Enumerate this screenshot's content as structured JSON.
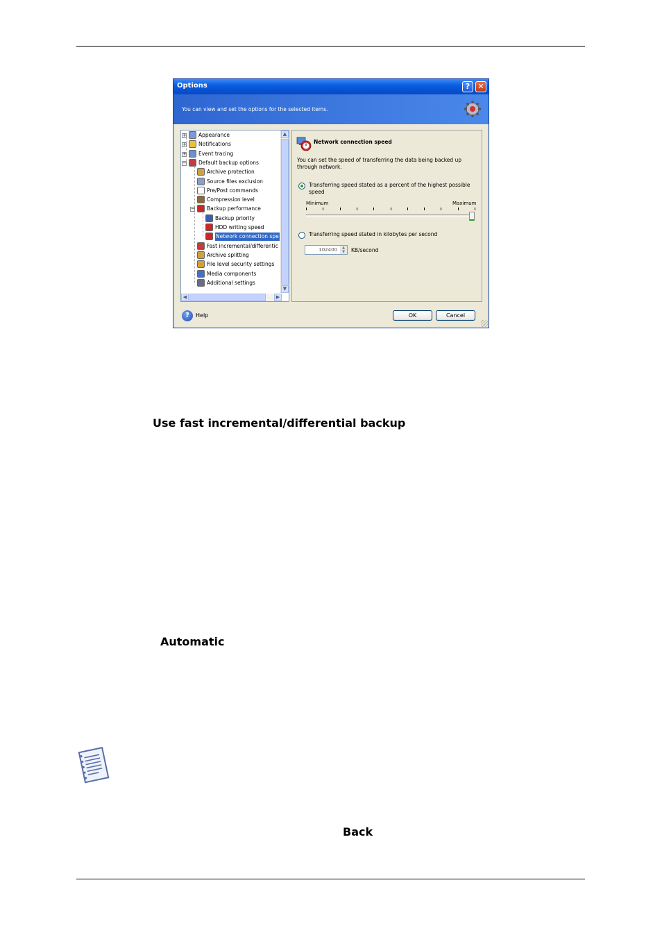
{
  "dialog": {
    "title": "Options",
    "description": "You can view and set the options for the selected items.",
    "tree": [
      {
        "label": "Appearance",
        "icon": "appearance-icon",
        "color": "#7a9ad8"
      },
      {
        "label": "Notifications",
        "icon": "notifications-icon",
        "color": "#e7c23a"
      },
      {
        "label": "Event tracing",
        "icon": "event-tracing-icon",
        "color": "#6c8fcf"
      },
      {
        "label": "Default backup options",
        "icon": "backup-options-icon",
        "color": "#c43c3c"
      },
      {
        "label": "Archive protection",
        "icon": "lock-icon",
        "color": "#c9a24a"
      },
      {
        "label": "Source files exclusion",
        "icon": "filter-icon",
        "color": "#8aa0c0"
      },
      {
        "label": "Pre/Post commands",
        "icon": "commands-icon",
        "color": "#ffffff"
      },
      {
        "label": "Compression level",
        "icon": "compression-icon",
        "color": "#8a6a3a"
      },
      {
        "label": "Backup performance",
        "icon": "performance-icon",
        "color": "#c82828"
      },
      {
        "label": "Backup priority",
        "icon": "priority-icon",
        "color": "#3a5fb0"
      },
      {
        "label": "HDD writing speed",
        "icon": "hdd-speed-icon",
        "color": "#c82828"
      },
      {
        "label": "Network connection spe",
        "icon": "network-speed-icon",
        "color": "#c82828"
      },
      {
        "label": "Fast incremental/differentic",
        "icon": "fast-incremental-icon",
        "color": "#c43c3c"
      },
      {
        "label": "Archive splitting",
        "icon": "archive-splitting-icon",
        "color": "#d0a040"
      },
      {
        "label": "File level security settings",
        "icon": "security-icon",
        "color": "#d8a030"
      },
      {
        "label": "Media components",
        "icon": "media-icon",
        "color": "#4870c0"
      },
      {
        "label": "Additional settings",
        "icon": "settings-icon",
        "color": "#6a6a8a"
      }
    ],
    "panel": {
      "heading": "Network connection speed",
      "description": "You can set the speed of transferring the data being backed up through network.",
      "option_percent": "Transferring speed stated as a percent of the highest possible speed",
      "slider_min": "Minimum",
      "slider_max": "Maximum",
      "slider_value_percent": 100,
      "option_kbps": "Transferring speed stated in kilobytes per second",
      "kbps_value": "102400",
      "kbps_unit": "KB/second",
      "selected_option": "percent"
    },
    "help_label": "Help",
    "ok_label": "OK",
    "cancel_label": "Cancel"
  },
  "document": {
    "heading_fast": "Use fast incremental/differential backup",
    "heading_automatic": "Automatic",
    "heading_back": "Back"
  },
  "colors": {
    "titlebar": "#0a5ee0",
    "selection": "#316ac5",
    "dialog_bg": "#ece9d8"
  }
}
